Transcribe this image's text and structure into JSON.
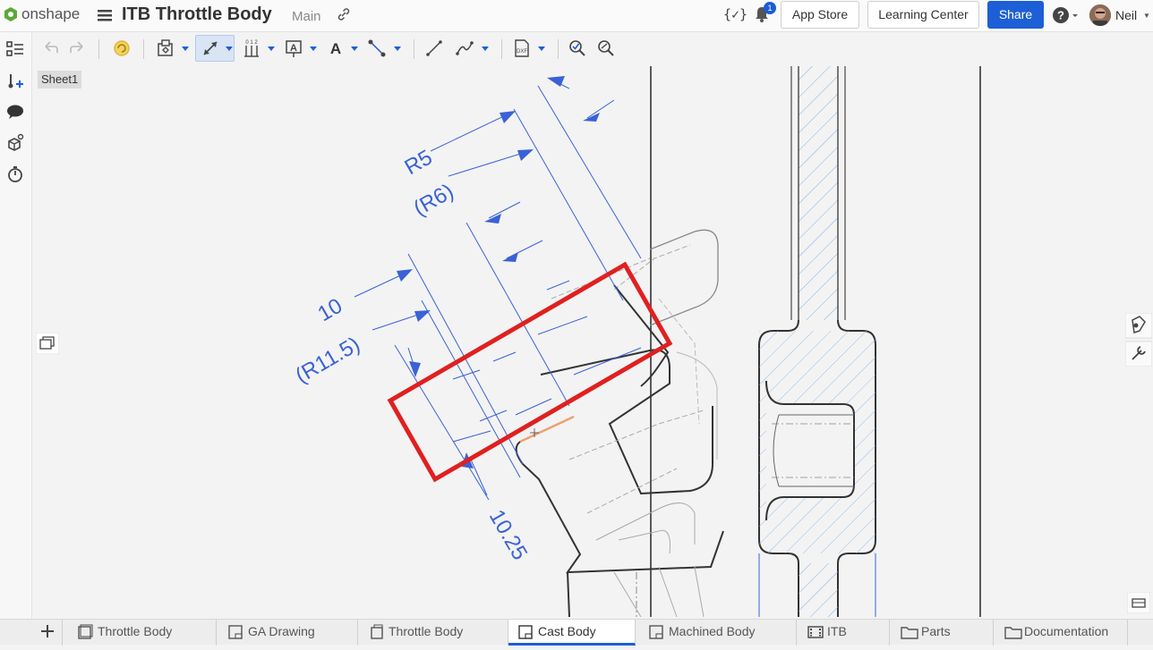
{
  "app": {
    "logo_text": "onshape",
    "document_title": "ITB Throttle Body",
    "branch": "Main"
  },
  "header": {
    "version_icon_text": "{✓}",
    "notification_count": "1",
    "app_store_label": "App Store",
    "learning_center_label": "Learning Center",
    "share_label": "Share",
    "user_name": "Neil"
  },
  "sheet": {
    "label": "Sheet1"
  },
  "drawing": {
    "dimensions": [
      "R5",
      "(R6)",
      "10",
      "(R11.5)",
      "10.25"
    ],
    "highlight_color": "#e02020",
    "dimension_color": "#3a62d6"
  },
  "tabs": [
    {
      "label": "Throttle Body",
      "icon": "assembly-icon"
    },
    {
      "label": "GA Drawing",
      "icon": "drawing-icon"
    },
    {
      "label": "Throttle Body",
      "icon": "part-studio-icon"
    },
    {
      "label": "Cast Body",
      "icon": "drawing-icon",
      "active": true
    },
    {
      "label": "Machined Body",
      "icon": "drawing-icon"
    },
    {
      "label": "ITB",
      "icon": "film-icon"
    },
    {
      "label": "Parts",
      "icon": "folder-icon"
    },
    {
      "label": "Documentation",
      "icon": "folder-icon"
    }
  ],
  "colors": {
    "accent": "#1d5fd6",
    "logo_green": "#5aa935"
  }
}
